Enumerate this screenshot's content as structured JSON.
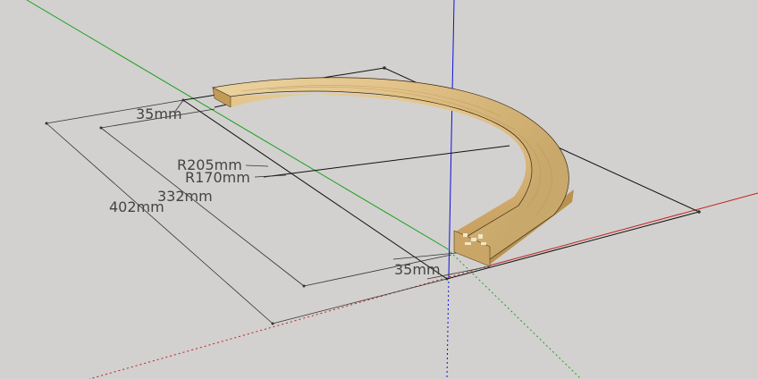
{
  "viewport": {
    "background": "#d2d1cf",
    "axis_colors": {
      "red": "#c02020",
      "green": "#20a020",
      "blue": "#1010e0"
    },
    "wood_colors": {
      "top": "#d8bb82",
      "edge": "#c7a163",
      "dark": "#9c7a40"
    }
  },
  "dimensions": {
    "top_width": "35mm",
    "bottom_width": "35mm",
    "outer_radius": "R205mm",
    "inner_radius": "R170mm",
    "inner_length": "332mm",
    "outer_length": "402mm"
  }
}
